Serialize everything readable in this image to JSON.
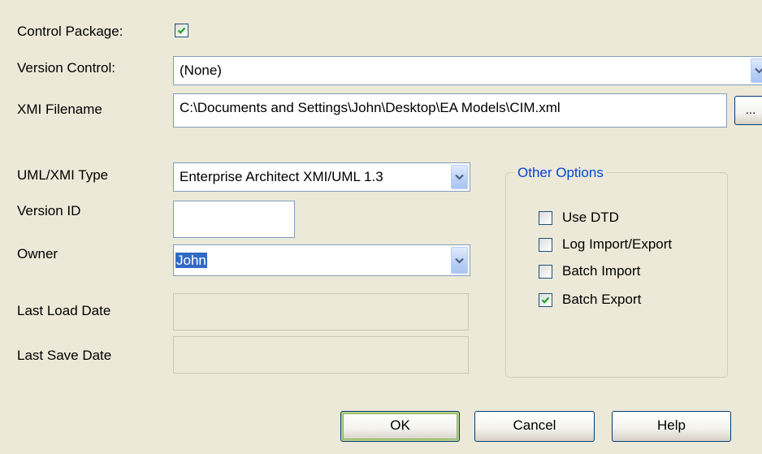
{
  "control_package": {
    "label": "Control Package:",
    "checked": true
  },
  "version_control": {
    "label": "Version Control:",
    "value": "(None)"
  },
  "xmi_filename": {
    "label": "XMI Filename",
    "value": "C:\\Documents and Settings\\John\\Desktop\\EA Models\\CIM.xml",
    "browse_label": "..."
  },
  "uml_xmi_type": {
    "label": "UML/XMI Type",
    "value": "Enterprise Architect XMI/UML 1.3"
  },
  "version_id": {
    "label": "Version ID",
    "value": ""
  },
  "owner": {
    "label": "Owner",
    "value": "John"
  },
  "last_load_date": {
    "label": "Last Load Date",
    "value": ""
  },
  "last_save_date": {
    "label": "Last Save Date",
    "value": ""
  },
  "other_options": {
    "title": "Other Options",
    "items": [
      {
        "label": "Use DTD",
        "checked": false
      },
      {
        "label": "Log Import/Export",
        "checked": false
      },
      {
        "label": "Batch Import",
        "checked": false
      },
      {
        "label": "Batch Export",
        "checked": true
      }
    ]
  },
  "buttons": {
    "ok": "OK",
    "cancel": "Cancel",
    "help": "Help"
  },
  "colors": {
    "dialog_bg": "#ece9d8",
    "field_border": "#7f9db9",
    "checkmark": "#21a121",
    "group_title": "#0046d5",
    "selection": "#316ac5"
  }
}
